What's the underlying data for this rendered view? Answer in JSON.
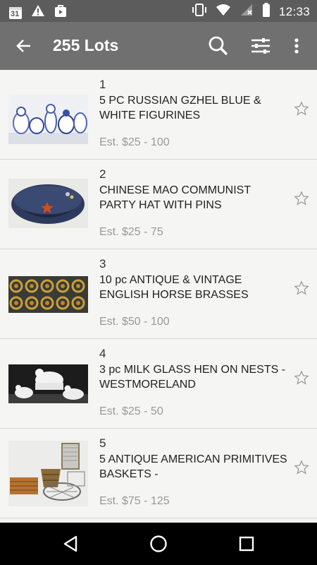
{
  "status": {
    "calendar_day": "31",
    "time": "12:33"
  },
  "appbar": {
    "title": "255 Lots"
  },
  "lots": [
    {
      "number": "1",
      "title": "5 PC RUSSIAN GZHEL BLUE & WHITE FIGURINES",
      "estimate": "Est. $25 - 100",
      "image": "figurines-photo"
    },
    {
      "number": "2",
      "title": "CHINESE MAO COMMUNIST PARTY HAT WITH PINS",
      "estimate": "Est. $25 - 75",
      "image": "hat-photo"
    },
    {
      "number": "3",
      "title": "10 pc ANTIQUE & VINTAGE ENGLISH HORSE BRASSES",
      "estimate": "Est. $50 - 100",
      "image": "horse-brasses-photo"
    },
    {
      "number": "4",
      "title": "3 pc MILK GLASS HEN ON NESTS - WESTMORELAND",
      "estimate": "Est. $25 - 50",
      "image": "milk-glass-photo"
    },
    {
      "number": "5",
      "title": "5 ANTIQUE AMERICAN PRIMITIVES BASKETS -",
      "estimate": "Est. $75 - 125",
      "image": "baskets-photo"
    }
  ],
  "colors": {
    "statusbar": "#5c5c5c",
    "appbar": "#707070",
    "estimate_text": "#999999",
    "list_bg": "#f5f5f3"
  }
}
